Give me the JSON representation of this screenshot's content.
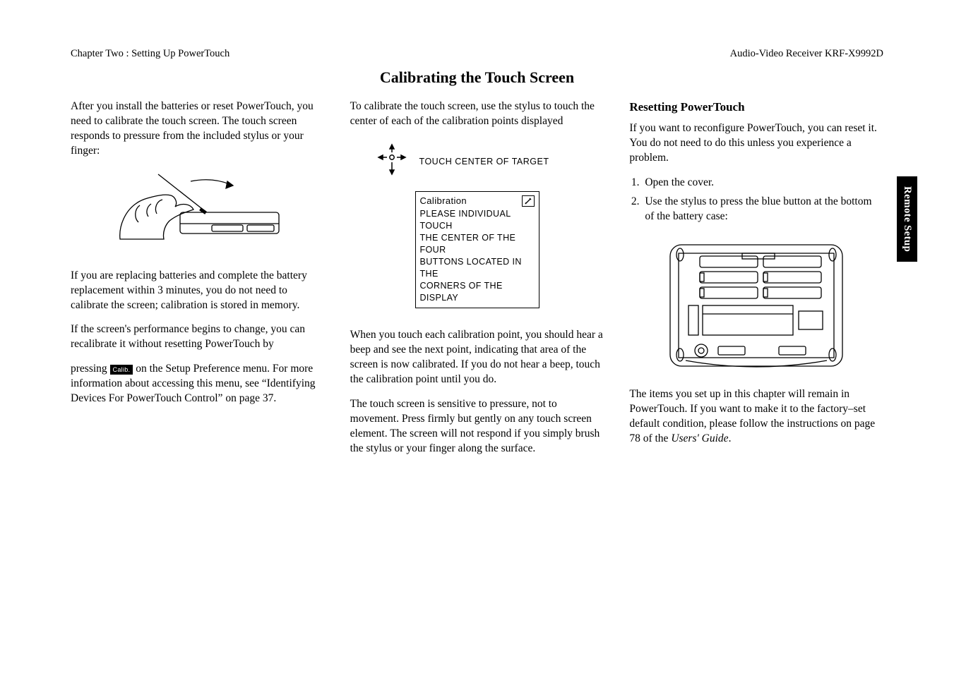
{
  "header": {
    "left": "Chapter Two : Setting Up PowerTouch",
    "right": "Audio-Video Receiver KRF-X9992D"
  },
  "title": "Calibrating the Touch Screen",
  "sidetab": "Remote Setup",
  "col1": {
    "p1": "After you install the batteries or reset PowerTouch, you need to calibrate the touch screen. The touch screen responds to pressure from the included stylus or your finger:",
    "p2": "If you are replacing batteries and complete the battery replacement within 3 minutes, you do not need to calibrate the screen; calibration is stored in memory.",
    "p3": "If the screen's performance begins to change, you can recalibrate it without resetting PowerTouch by",
    "p4a": "pressing ",
    "calib_btn": "Calib.",
    "p4b": " on the Setup Preference menu. For more information about accessing this menu, see “Identifying Devices For PowerTouch Control” on page 37."
  },
  "col2": {
    "p1": "To calibrate the touch screen, use the stylus to touch the center of each of the calibration points displayed",
    "target_label": "TOUCH CENTER OF TARGET",
    "box_title": "Calibration",
    "box_l1": "PLEASE INDIVIDUAL TOUCH",
    "box_l2": "THE CENTER OF THE FOUR",
    "box_l3": "BUTTONS LOCATED IN THE",
    "box_l4": "CORNERS OF THE DISPLAY",
    "p2": "When you touch each calibration point, you should hear a beep and see the next point, indicating that area of the screen is now calibrated. If you do not hear a beep, touch the calibration point until you do.",
    "p3": "The touch screen is sensitive to pressure, not to movement. Press firmly but gently on any touch screen element. The screen will not respond if you simply brush the stylus or your finger along the surface."
  },
  "col3": {
    "h": "Resetting PowerTouch",
    "p1": "If you want to reconfigure PowerTouch, you can reset it. You do not need to do this unless you experience a problem.",
    "li1": "Open the  cover.",
    "li2": "Use the stylus to press the blue button at the bottom of the battery case:",
    "p2a": "The items you set up in this chapter will remain in PowerTouch. If you want to make it to the factory–set default condition, please follow the instructions on page 78 of the ",
    "p2b": "Users' Guide",
    "p2c": "."
  }
}
